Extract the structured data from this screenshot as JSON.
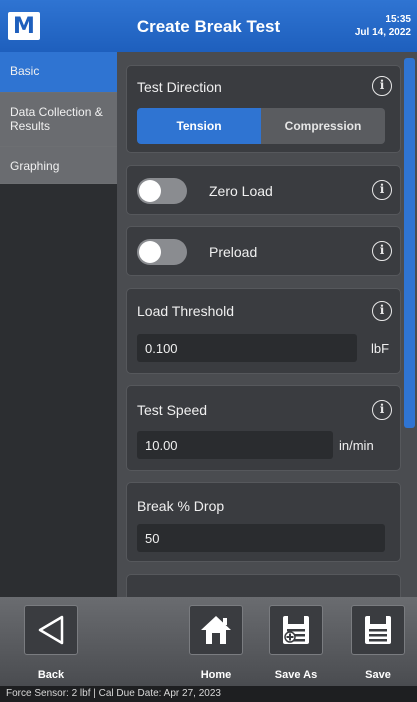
{
  "header": {
    "logo_letter": "M",
    "title": "Create Break Test",
    "time": "15:35",
    "date": "Jul 14, 2022"
  },
  "sidebar": {
    "items": [
      {
        "label": "Basic"
      },
      {
        "label": "Data Collection & Results"
      },
      {
        "label": "Graphing"
      }
    ]
  },
  "main": {
    "test_direction": {
      "label": "Test Direction",
      "options": [
        "Tension",
        "Compression"
      ],
      "selected": "Tension"
    },
    "zero_load": {
      "label": "Zero Load",
      "enabled": false
    },
    "preload": {
      "label": "Preload",
      "enabled": false
    },
    "load_threshold": {
      "label": "Load Threshold",
      "value": "0.100",
      "unit": "lbF"
    },
    "test_speed": {
      "label": "Test Speed",
      "value": "10.00",
      "unit": "in/min"
    },
    "break_drop": {
      "label": "Break % Drop",
      "value": "50"
    }
  },
  "toolbar": {
    "back_label": "Back",
    "home_label": "Home",
    "save_as_label": "Save As",
    "save_label": "Save"
  },
  "status": {
    "text": "Force Sensor: 2 lbf  |  Cal Due Date: Apr 27, 2023"
  },
  "colors": {
    "accent": "#2f74d2",
    "panel": "#3a3c40",
    "background": "#4a4c50"
  },
  "icons": {
    "info": "info-icon",
    "back": "back-triangle-icon",
    "home": "home-icon",
    "save_as": "save-as-icon",
    "save": "save-icon"
  }
}
